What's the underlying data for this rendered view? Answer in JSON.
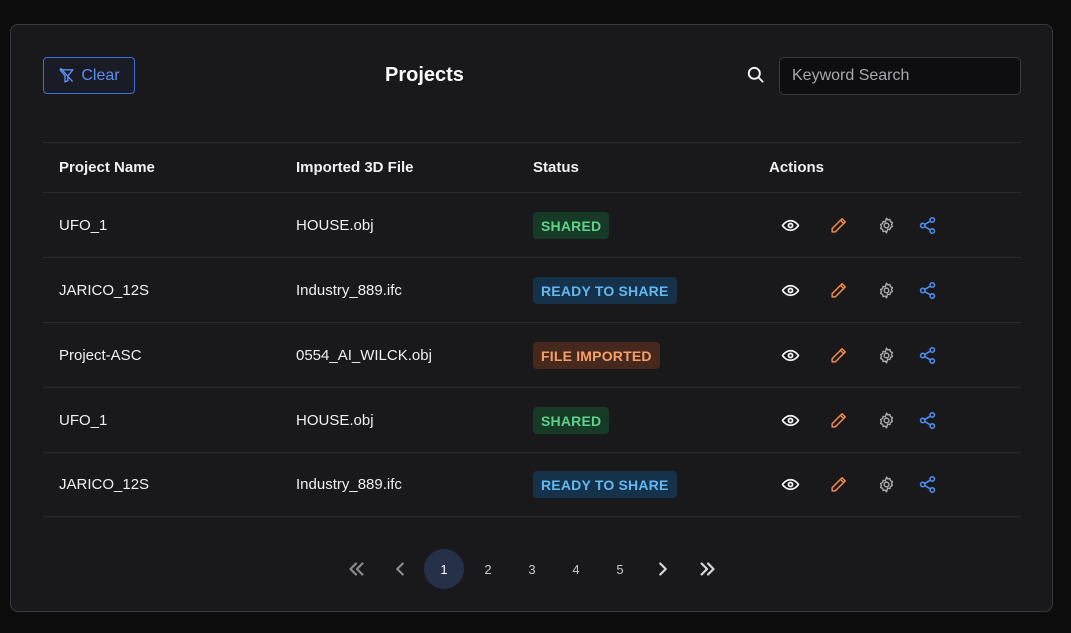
{
  "header": {
    "title": "Projects",
    "clear_label": "Clear",
    "search_placeholder": "Keyword Search",
    "search_value": ""
  },
  "table": {
    "columns": [
      "Project Name",
      "Imported 3D File",
      "Status",
      "Actions"
    ],
    "rows": [
      {
        "name": "UFO_1",
        "file": "HOUSE.obj",
        "status": "SHARED"
      },
      {
        "name": "JARICO_12S",
        "file": "Industry_889.ifc",
        "status": "READY TO SHARE"
      },
      {
        "name": "Project-ASC",
        "file": "0554_AI_WILCK.obj",
        "status": "FILE IMPORTED"
      },
      {
        "name": "UFO_1",
        "file": "HOUSE.obj",
        "status": "SHARED"
      },
      {
        "name": "JARICO_12S",
        "file": "Industry_889.ifc",
        "status": "READY TO SHARE"
      }
    ],
    "actions": [
      "eye-icon",
      "pencil-icon",
      "gear-icon",
      "share-icon"
    ]
  },
  "status_styles": {
    "SHARED": {
      "bg": "#173a27",
      "fg": "#5fd28a"
    },
    "READY TO SHARE": {
      "bg": "#16324a",
      "fg": "#62b8f0"
    },
    "FILE IMPORTED": {
      "bg": "#46291c",
      "fg": "#f5a06a"
    }
  },
  "pagination": {
    "pages": [
      "1",
      "2",
      "3",
      "4",
      "5"
    ],
    "current": "1"
  },
  "colors": {
    "accent": "#5b8ff5",
    "edit": "#f08a4b",
    "share": "#4f8df0"
  }
}
